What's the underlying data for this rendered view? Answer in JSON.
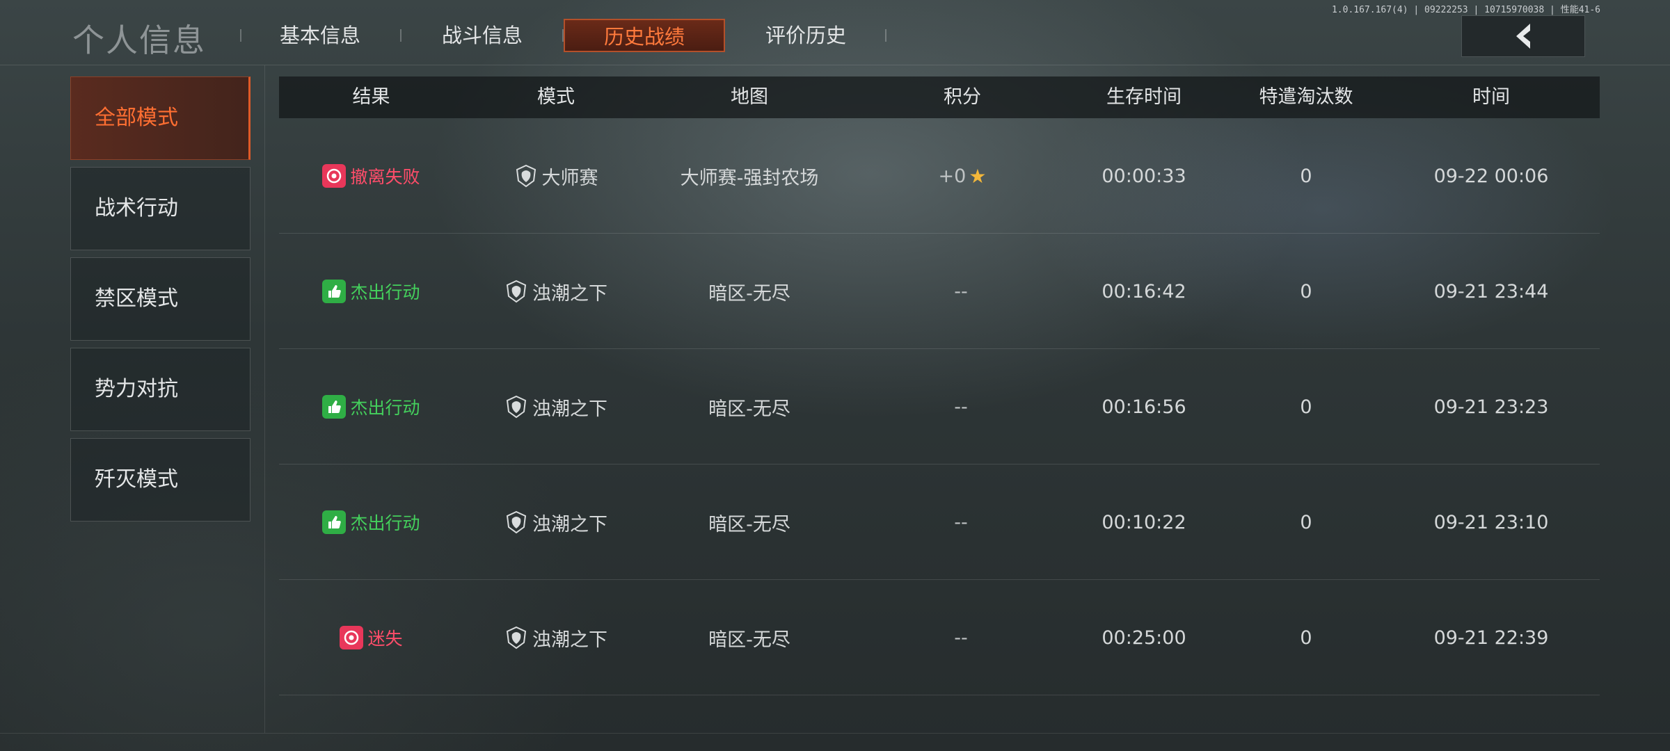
{
  "debug_text": "1.0.167.167(4) | 09222253 | 10715970038 | 性能41-6",
  "page_title": "个人信息",
  "tabs": [
    {
      "label": "基本信息"
    },
    {
      "label": "战斗信息"
    },
    {
      "label": "历史战绩",
      "active": true
    },
    {
      "label": "评价历史"
    }
  ],
  "back_icon": "chevron-left-icon",
  "sidebar": [
    {
      "label": "全部模式",
      "active": true
    },
    {
      "label": "战术行动"
    },
    {
      "label": "禁区模式"
    },
    {
      "label": "势力对抗"
    },
    {
      "label": "歼灭模式"
    }
  ],
  "table": {
    "headers": [
      "结果",
      "模式",
      "地图",
      "积分",
      "生存时间",
      "特遣淘汰数",
      "时间"
    ],
    "rows": [
      {
        "result": "撤离失败",
        "result_type": "fail",
        "mode": "大师赛",
        "map": "大师赛-强封农场",
        "score": "+0",
        "score_star": "★",
        "survival": "00:00:33",
        "eliminations": "0",
        "time": "09-22 00:06"
      },
      {
        "result": "杰出行动",
        "result_type": "ok",
        "mode": "浊潮之下",
        "map": "暗区-无尽",
        "score": "--",
        "score_star": "",
        "survival": "00:16:42",
        "eliminations": "0",
        "time": "09-21 23:44"
      },
      {
        "result": "杰出行动",
        "result_type": "ok",
        "mode": "浊潮之下",
        "map": "暗区-无尽",
        "score": "--",
        "score_star": "",
        "survival": "00:16:56",
        "eliminations": "0",
        "time": "09-21 23:23"
      },
      {
        "result": "杰出行动",
        "result_type": "ok",
        "mode": "浊潮之下",
        "map": "暗区-无尽",
        "score": "--",
        "score_star": "",
        "survival": "00:10:22",
        "eliminations": "0",
        "time": "09-21 23:10"
      },
      {
        "result": "迷失",
        "result_type": "fail",
        "mode": "浊潮之下",
        "map": "暗区-无尽",
        "score": "--",
        "score_star": "",
        "survival": "00:25:00",
        "eliminations": "0",
        "time": "09-21 22:39"
      }
    ]
  },
  "colors": {
    "accent": "#ff6f32",
    "fail": "#ff4d6a",
    "success": "#44d05c",
    "star": "#f3b73a"
  }
}
